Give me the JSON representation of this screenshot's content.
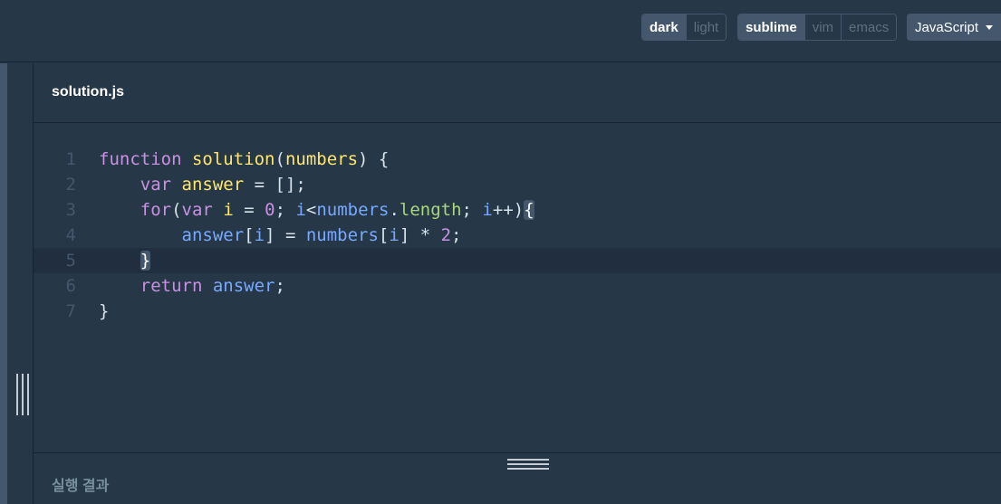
{
  "toolbar": {
    "theme_options": [
      {
        "label": "dark",
        "active": true
      },
      {
        "label": "light",
        "active": false
      }
    ],
    "keymap_options": [
      {
        "label": "sublime",
        "active": true
      },
      {
        "label": "vim",
        "active": false
      },
      {
        "label": "emacs",
        "active": false
      }
    ],
    "language": "JavaScript"
  },
  "editor": {
    "filename": "solution.js",
    "active_line": 5,
    "lines": [
      {
        "n": "1",
        "tokens": [
          [
            "kw",
            "function"
          ],
          [
            "op",
            " "
          ],
          [
            "fn",
            "solution"
          ],
          [
            "op",
            "("
          ],
          [
            "var",
            "numbers"
          ],
          [
            "op",
            ") {"
          ]
        ]
      },
      {
        "n": "2",
        "tokens": [
          [
            "op",
            "    "
          ],
          [
            "kw",
            "var"
          ],
          [
            "op",
            " "
          ],
          [
            "var",
            "answer"
          ],
          [
            "op",
            " = [];"
          ]
        ]
      },
      {
        "n": "3",
        "tokens": [
          [
            "op",
            "    "
          ],
          [
            "kw",
            "for"
          ],
          [
            "op",
            "("
          ],
          [
            "kw",
            "var"
          ],
          [
            "op",
            " "
          ],
          [
            "var",
            "i"
          ],
          [
            "op",
            " = "
          ],
          [
            "num",
            "0"
          ],
          [
            "op",
            "; "
          ],
          [
            "id",
            "i"
          ],
          [
            "op",
            "<"
          ],
          [
            "id",
            "numbers"
          ],
          [
            "op",
            "."
          ],
          [
            "prop",
            "length"
          ],
          [
            "op",
            "; "
          ],
          [
            "id",
            "i"
          ],
          [
            "op",
            "++)"
          ],
          [
            "match",
            "{"
          ]
        ]
      },
      {
        "n": "4",
        "tokens": [
          [
            "op",
            "        "
          ],
          [
            "id",
            "answer"
          ],
          [
            "op",
            "["
          ],
          [
            "id",
            "i"
          ],
          [
            "op",
            "] = "
          ],
          [
            "id",
            "numbers"
          ],
          [
            "op",
            "["
          ],
          [
            "id",
            "i"
          ],
          [
            "op",
            "] * "
          ],
          [
            "num",
            "2"
          ],
          [
            "op",
            ";"
          ]
        ]
      },
      {
        "n": "5",
        "tokens": [
          [
            "op",
            "    "
          ],
          [
            "match",
            "}"
          ]
        ]
      },
      {
        "n": "6",
        "tokens": [
          [
            "op",
            "    "
          ],
          [
            "kw",
            "return"
          ],
          [
            "op",
            " "
          ],
          [
            "id",
            "answer"
          ],
          [
            "op",
            ";"
          ]
        ]
      },
      {
        "n": "7",
        "tokens": [
          [
            "op",
            "}"
          ]
        ]
      }
    ]
  },
  "result": {
    "title": "실행 결과"
  }
}
